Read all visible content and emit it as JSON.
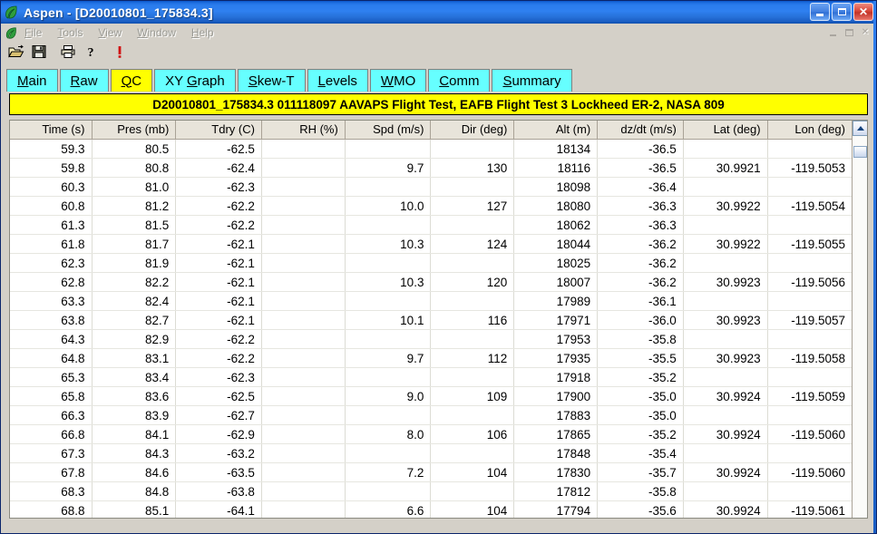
{
  "window": {
    "title": "Aspen - [D20010801_175834.3]",
    "app_icon": "leaf-icon",
    "minimize_label": "",
    "maximize_label": "",
    "close_label": "✕"
  },
  "menu": {
    "items": [
      {
        "label": "File",
        "accel": "F"
      },
      {
        "label": "Tools",
        "accel": "T"
      },
      {
        "label": "View",
        "accel": "V"
      },
      {
        "label": "Window",
        "accel": "W"
      },
      {
        "label": "Help",
        "accel": "H"
      }
    ],
    "mdi": {
      "restore": "□",
      "close": "✕"
    }
  },
  "toolbar": {
    "buttons": [
      {
        "name": "open-icon",
        "label": "Open"
      },
      {
        "name": "save-icon",
        "label": "Save"
      },
      {
        "name": "print-icon",
        "label": "Print"
      },
      {
        "name": "help-icon",
        "label": "Help"
      },
      {
        "name": "alert-icon",
        "label": "Alert"
      }
    ]
  },
  "tabs": {
    "active": "QC",
    "items": [
      {
        "label": "Main",
        "accel": "M",
        "rest": "ain"
      },
      {
        "label": "Raw",
        "accel": "R",
        "rest": "aw"
      },
      {
        "label": "QC",
        "accel": "Q",
        "rest": "C"
      },
      {
        "label": "XY Graph",
        "accel": "G",
        "pre": "XY ",
        "rest": "raph"
      },
      {
        "label": "Skew-T",
        "accel": "S",
        "rest": "kew-T"
      },
      {
        "label": "Levels",
        "accel": "L",
        "rest": "evels"
      },
      {
        "label": "WMO",
        "accel": "W",
        "rest": "MO"
      },
      {
        "label": "Comm",
        "accel": "C",
        "rest": "omm"
      },
      {
        "label": "Summary",
        "accel": "S",
        "rest": "ummary"
      }
    ]
  },
  "banner": {
    "text": "D20010801_175834.3 011118097 AAVAPS Flight Test, EAFB Flight Test 3 Lockheed ER-2, NASA 809"
  },
  "table": {
    "columns": [
      "Time (s)",
      "Pres (mb)",
      "Tdry (C)",
      "RH (%)",
      "Spd (m/s)",
      "Dir (deg)",
      "Alt (m)",
      "dz/dt (m/s)",
      "Lat (deg)",
      "Lon (deg)"
    ],
    "rows": [
      [
        "59.3",
        "80.5",
        "-62.5",
        "",
        "",
        "",
        "18134",
        "-36.5",
        "",
        ""
      ],
      [
        "59.8",
        "80.8",
        "-62.4",
        "",
        "9.7",
        "130",
        "18116",
        "-36.5",
        "30.9921",
        "-119.5053"
      ],
      [
        "60.3",
        "81.0",
        "-62.3",
        "",
        "",
        "",
        "18098",
        "-36.4",
        "",
        ""
      ],
      [
        "60.8",
        "81.2",
        "-62.2",
        "",
        "10.0",
        "127",
        "18080",
        "-36.3",
        "30.9922",
        "-119.5054"
      ],
      [
        "61.3",
        "81.5",
        "-62.2",
        "",
        "",
        "",
        "18062",
        "-36.3",
        "",
        ""
      ],
      [
        "61.8",
        "81.7",
        "-62.1",
        "",
        "10.3",
        "124",
        "18044",
        "-36.2",
        "30.9922",
        "-119.5055"
      ],
      [
        "62.3",
        "81.9",
        "-62.1",
        "",
        "",
        "",
        "18025",
        "-36.2",
        "",
        ""
      ],
      [
        "62.8",
        "82.2",
        "-62.1",
        "",
        "10.3",
        "120",
        "18007",
        "-36.2",
        "30.9923",
        "-119.5056"
      ],
      [
        "63.3",
        "82.4",
        "-62.1",
        "",
        "",
        "",
        "17989",
        "-36.1",
        "",
        ""
      ],
      [
        "63.8",
        "82.7",
        "-62.1",
        "",
        "10.1",
        "116",
        "17971",
        "-36.0",
        "30.9923",
        "-119.5057"
      ],
      [
        "64.3",
        "82.9",
        "-62.2",
        "",
        "",
        "",
        "17953",
        "-35.8",
        "",
        ""
      ],
      [
        "64.8",
        "83.1",
        "-62.2",
        "",
        "9.7",
        "112",
        "17935",
        "-35.5",
        "30.9923",
        "-119.5058"
      ],
      [
        "65.3",
        "83.4",
        "-62.3",
        "",
        "",
        "",
        "17918",
        "-35.2",
        "",
        ""
      ],
      [
        "65.8",
        "83.6",
        "-62.5",
        "",
        "9.0",
        "109",
        "17900",
        "-35.0",
        "30.9924",
        "-119.5059"
      ],
      [
        "66.3",
        "83.9",
        "-62.7",
        "",
        "",
        "",
        "17883",
        "-35.0",
        "",
        ""
      ],
      [
        "66.8",
        "84.1",
        "-62.9",
        "",
        "8.0",
        "106",
        "17865",
        "-35.2",
        "30.9924",
        "-119.5060"
      ],
      [
        "67.3",
        "84.3",
        "-63.2",
        "",
        "",
        "",
        "17848",
        "-35.4",
        "",
        ""
      ],
      [
        "67.8",
        "84.6",
        "-63.5",
        "",
        "7.2",
        "104",
        "17830",
        "-35.7",
        "30.9924",
        "-119.5060"
      ],
      [
        "68.3",
        "84.8",
        "-63.8",
        "",
        "",
        "",
        "17812",
        "-35.8",
        "",
        ""
      ],
      [
        "68.8",
        "85.1",
        "-64.1",
        "",
        "6.6",
        "104",
        "17794",
        "-35.6",
        "30.9924",
        "-119.5061"
      ]
    ]
  },
  "colors": {
    "titlebar": "#2f80f0",
    "tab_inactive": "#66ffff",
    "tab_active": "#ffff00",
    "banner": "#ffff00",
    "window_face": "#d4d0c8",
    "header": "#e8e4da"
  }
}
